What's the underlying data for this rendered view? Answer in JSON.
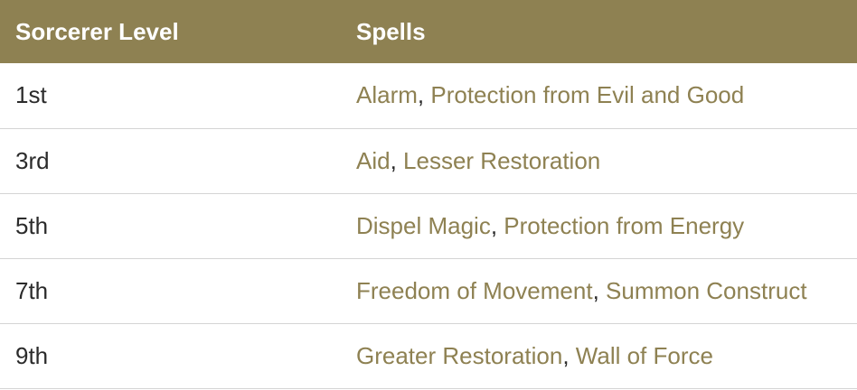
{
  "table": {
    "headers": {
      "level": "Sorcerer Level",
      "spells": "Spells"
    },
    "rows": [
      {
        "level": "1st",
        "spell_a": "Alarm",
        "separator": ", ",
        "spell_b": "Protection from Evil and Good"
      },
      {
        "level": "3rd",
        "spell_a": "Aid",
        "separator": ", ",
        "spell_b": "Lesser Restoration"
      },
      {
        "level": "5th",
        "spell_a": "Dispel Magic",
        "separator": ", ",
        "spell_b": "Protection from Energy"
      },
      {
        "level": "7th",
        "spell_a": "Freedom of Movement",
        "separator": ", ",
        "spell_b": "Summon Construct"
      },
      {
        "level": "9th",
        "spell_a": "Greater Restoration",
        "separator": ", ",
        "spell_b": "Wall of Force"
      }
    ]
  },
  "colors": {
    "header_bg": "#8e8152",
    "link": "#8e8152",
    "text": "#2b2b2b",
    "divider": "#d4d4d4"
  }
}
